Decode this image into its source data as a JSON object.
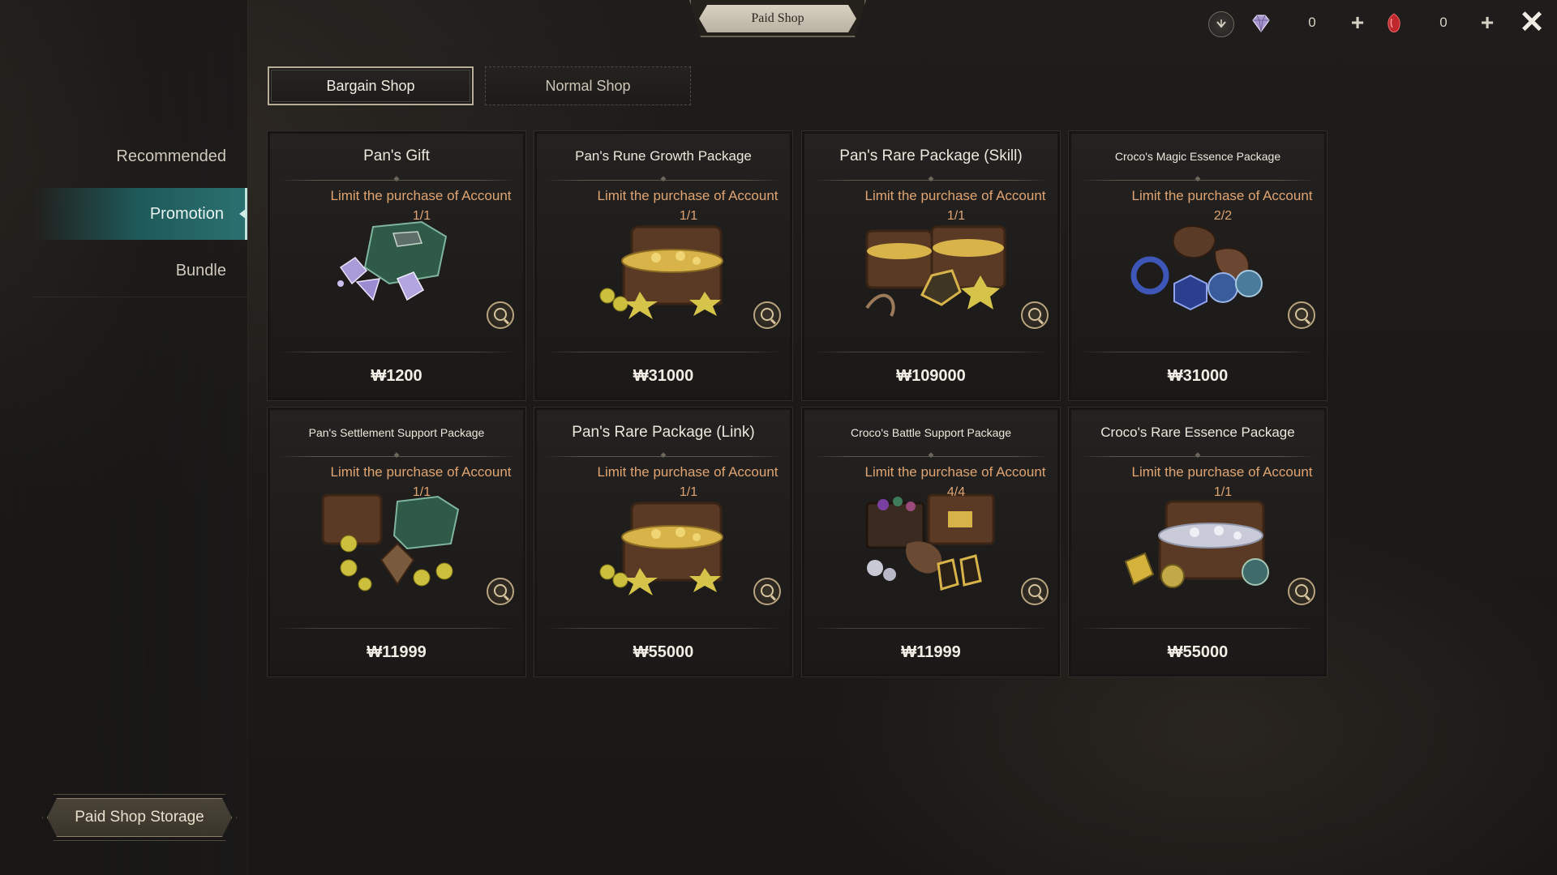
{
  "header": {
    "title": "Paid Shop",
    "currencies": [
      {
        "icon": "gem-crystal-icon",
        "value": "0",
        "color": "#b7a6d6"
      },
      {
        "icon": "red-gem-icon",
        "value": "0",
        "color": "#c0272d"
      }
    ]
  },
  "tabs": [
    {
      "label": "Bargain Shop",
      "active": true
    },
    {
      "label": "Normal Shop",
      "active": false
    }
  ],
  "sidebar": {
    "items": [
      {
        "label": "Recommended",
        "active": false
      },
      {
        "label": "Promotion",
        "active": true
      },
      {
        "label": "Bundle",
        "active": false
      }
    ],
    "storage_label": "Paid Shop Storage"
  },
  "cards": [
    {
      "title": "Pan's Gift",
      "title_size": "large",
      "limit": "Limit the purchase of Account",
      "count": "1/1",
      "price": "₩1200",
      "art": "gems-box"
    },
    {
      "title": "Pan's Rune Growth Package",
      "title_size": "medium",
      "limit": "Limit the purchase of Account",
      "count": "1/1",
      "price": "₩31000",
      "art": "gold-chest"
    },
    {
      "title": "Pan's Rare Package (Skill)",
      "title_size": "large",
      "limit": "Limit the purchase of Account",
      "count": "1/1",
      "price": "₩109000",
      "art": "double-chest"
    },
    {
      "title": "Croco's Magic Essence Package",
      "title_size": "small",
      "limit": "Limit the purchase of Account",
      "count": "2/2",
      "price": "₩31000",
      "art": "essence-bag"
    },
    {
      "title": "Pan's Settlement Support Package",
      "title_size": "small",
      "limit": "Limit the purchase of Account",
      "count": "1/1",
      "price": "₩11999",
      "art": "settlement-boxes"
    },
    {
      "title": "Pan's Rare Package (Link)",
      "title_size": "large",
      "limit": "Limit the purchase of Account",
      "count": "1/1",
      "price": "₩55000",
      "art": "gold-chest"
    },
    {
      "title": "Croco's Battle Support Package",
      "title_size": "small",
      "limit": "Limit the purchase of Account",
      "count": "4/4",
      "price": "₩11999",
      "art": "battle-box"
    },
    {
      "title": "Croco's Rare Essence Package",
      "title_size": "medium",
      "limit": "Limit the purchase of Account",
      "count": "1/1",
      "price": "₩55000",
      "art": "silver-chest"
    }
  ]
}
